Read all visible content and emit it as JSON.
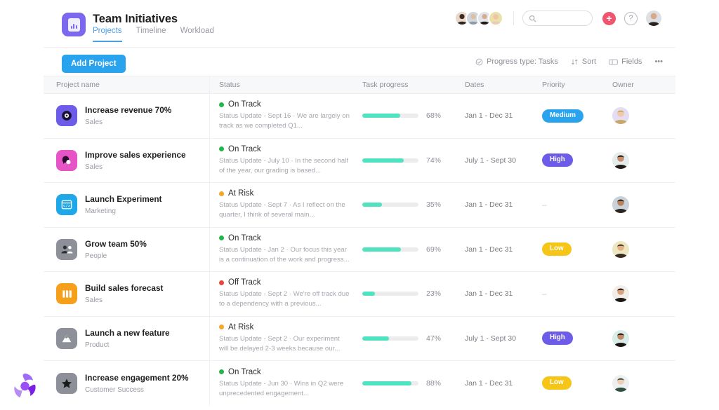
{
  "header": {
    "app_icon": "project-app-icon",
    "title": "Team Initiatives",
    "tabs": [
      {
        "label": "Projects",
        "active": true
      },
      {
        "label": "Timeline",
        "active": false
      },
      {
        "label": "Workload",
        "active": false
      }
    ],
    "search": {
      "value": "",
      "placeholder": ""
    },
    "add_button_label": "+",
    "help_label": "?",
    "member_avatars": [
      "member-1",
      "member-2",
      "member-3",
      "member-4"
    ],
    "current_user_avatar": "current-user"
  },
  "toolbar": {
    "add_project_label": "Add Project",
    "progress_type_label": "Progress type: Tasks",
    "sort_label": "Sort",
    "fields_label": "Fields",
    "more_label": "•••"
  },
  "table": {
    "columns": [
      "Project name",
      "Status",
      "Task progress",
      "Dates",
      "Priority",
      "Owner"
    ],
    "rows": [
      {
        "icon": "target-icon",
        "icon_bg": "#6c5ce7",
        "name": "Increase revenue 70%",
        "team": "Sales",
        "status": "On Track",
        "status_color": "#25b34b",
        "note": "Status Update - Sept 16 · We are largely on track as we completed Q1...",
        "progress": 68,
        "progress_label": "68%",
        "dates": "Jan 1 - Dec 31",
        "priority": "Medium",
        "priority_color": "#2aa3ef",
        "owner": "owner-1"
      },
      {
        "icon": "speech-bubble-icon",
        "icon_bg": "#e754c6",
        "name": "Improve sales experience",
        "team": "Sales",
        "status": "On Track",
        "status_color": "#25b34b",
        "note": "Status Update - July 10 · In the second half of the year, our grading is based...",
        "progress": 74,
        "progress_label": "74%",
        "dates": "July 1 - Sept 30",
        "priority": "High",
        "priority_color": "#6c5ce7",
        "owner": "owner-2"
      },
      {
        "icon": "code-window-icon",
        "icon_bg": "#1fa8e8",
        "name": "Launch Experiment",
        "team": "Marketing",
        "status": "At Risk",
        "status_color": "#f5a623",
        "note": "Status Update - Sept 7 · As I reflect on the quarter, I think of several main...",
        "progress": 35,
        "progress_label": "35%",
        "dates": "Jan 1 - Dec 31",
        "priority": "",
        "priority_color": "",
        "owner": "owner-3"
      },
      {
        "icon": "people-icon",
        "icon_bg": "#8e9099",
        "name": "Grow team 50%",
        "team": "People",
        "status": "On Track",
        "status_color": "#25b34b",
        "note": "Status Update - Jan 2 · Our focus this year is a continuation of the work and progress...",
        "progress": 69,
        "progress_label": "69%",
        "dates": "Jan 1 - Dec 31",
        "priority": "Low",
        "priority_color": "#f5c518",
        "owner": "owner-4"
      },
      {
        "icon": "bars-icon",
        "icon_bg": "#f59f1b",
        "name": "Build sales forecast",
        "team": "Sales",
        "status": "Off Track",
        "status_color": "#e8453c",
        "note": "Status Update - Sept 2 · We're off track due to a dependency with a previous...",
        "progress": 23,
        "progress_label": "23%",
        "dates": "Jan 1 - Dec 31",
        "priority": "",
        "priority_color": "",
        "owner": "owner-5"
      },
      {
        "icon": "mountain-icon",
        "icon_bg": "#8e9099",
        "name": "Launch a new feature",
        "team": "Product",
        "status": "At Risk",
        "status_color": "#f5a623",
        "note": "Status Update - Sept 2 · Our experiment will be delayed 2-3 weeks because our...",
        "progress": 47,
        "progress_label": "47%",
        "dates": "July 1 - Sept 30",
        "priority": "High",
        "priority_color": "#6c5ce7",
        "owner": "owner-6"
      },
      {
        "icon": "star-icon",
        "icon_bg": "#8e9099",
        "name": "Increase engagement 20%",
        "team": "Customer Success",
        "status": "On Track",
        "status_color": "#25b34b",
        "note": "Status Update - Jun 30 · Wins in Q2 were unprecedented engagement...",
        "progress": 88,
        "progress_label": "88%",
        "dates": "Jan 1 - Dec 31",
        "priority": "Low",
        "priority_color": "#f5c518",
        "owner": "owner-7"
      }
    ]
  },
  "colors": {
    "accent_blue": "#2aa3ef",
    "progress_fill": "#4fe3c1",
    "brand_purple": "#8b3ff0"
  }
}
